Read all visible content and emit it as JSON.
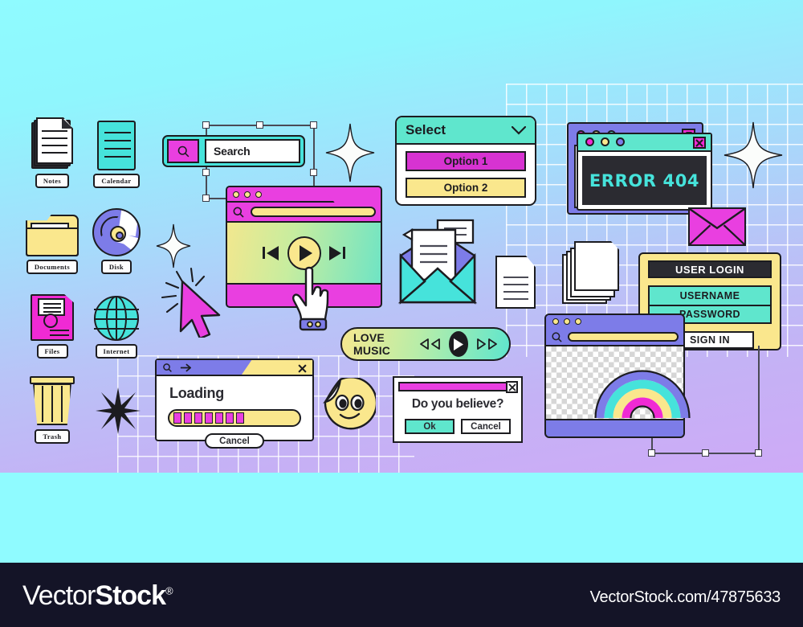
{
  "canvas": {
    "background_top": "#8ffbff",
    "background_bottom": "#ceaaf6"
  },
  "desktop_icons": [
    {
      "name": "notes",
      "label": "Notes"
    },
    {
      "name": "calendar",
      "label": "Calendar"
    },
    {
      "name": "documents",
      "label": "Documents"
    },
    {
      "name": "disk",
      "label": "Disk"
    },
    {
      "name": "files",
      "label": "Files"
    },
    {
      "name": "internet",
      "label": "Internet"
    },
    {
      "name": "trash",
      "label": "Trash"
    }
  ],
  "search_widget": {
    "icon": "magnifier-icon",
    "value": "Search",
    "button_color": "#e93fe0",
    "frame_color": "#46e3db"
  },
  "video_player": {
    "dots": 3,
    "address_icon": "magnifier-icon",
    "prev_label": "previous-track",
    "play_label": "play",
    "next_label": "next-track"
  },
  "select_dropdown": {
    "title": "Select",
    "chevron": "chevron-down-icon",
    "options": [
      {
        "label": "Option 1",
        "color": "#d733d1"
      },
      {
        "label": "Option 2",
        "color": "#fae78d"
      }
    ]
  },
  "error_window": {
    "message": "ERROR 404",
    "text_color": "#46e3db",
    "screen_color": "#2b2b31",
    "titlebar_color": "#5fe6cd",
    "close_icon": "close-icon",
    "back_titlebar_color": "#7d7ce8"
  },
  "user_login": {
    "title": "USER LOGIN",
    "username_placeholder": "USERNAME",
    "password_placeholder": "PASSWORD",
    "submit_label": "SIGN IN",
    "panel_color": "#fae78d",
    "field_color": "#5fe6cd"
  },
  "loading_dialog": {
    "title": "Loading",
    "progress_blocks": 7,
    "progress_total": 7,
    "cancel_label": "Cancel",
    "titlebar_color": "#7d7ce8",
    "tab_color": "#fae78d",
    "icons": [
      "magnifier-icon",
      "arrow-right-icon",
      "close-icon"
    ]
  },
  "confirm_dialog": {
    "question": "Do you believe?",
    "ok_label": "Ok",
    "cancel_label": "Cancel",
    "close_icon": "close-icon",
    "titlebar_color": "#e93fe0"
  },
  "music_player": {
    "title": "LOVE MUSIC",
    "rewind_icon": "rewind-icon",
    "play_icon": "play-icon",
    "forward_icon": "fast-forward-icon"
  },
  "rainbow_window": {
    "dots": 3,
    "address_icon": "magnifier-icon",
    "rainbow_colors": [
      "#7d7ce8",
      "#46e3db",
      "#fae78d",
      "#f02ad4"
    ],
    "canvas_style": "transparency-checkerboard"
  },
  "decor": {
    "sparkles": 3,
    "black_star": "8-point-star",
    "cursor_arrow": "arrow-cursor-magenta",
    "cursor_hand": "pointing-hand-cursor",
    "magenta_envelope": "mail-icon",
    "teal_envelope": "open-mail-icon",
    "single_document": "document-icon",
    "document_stack": "documents-stack-icon",
    "emoji": "smiley-face-sticker",
    "selection_handles": "transform-handles"
  },
  "watermark": {
    "brand_light": "Vector",
    "brand_bold": "Stock",
    "registered": "®",
    "url": "VectorStock.com/47875633"
  }
}
